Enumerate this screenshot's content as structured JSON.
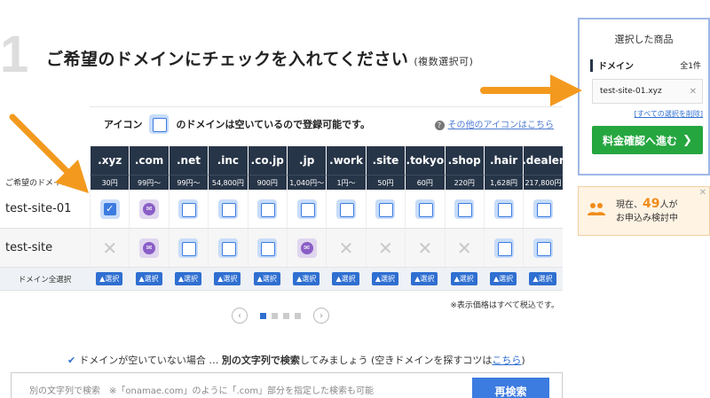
{
  "step": {
    "number": "1",
    "title": "ご希望のドメインにチェックを入れてください",
    "subtitle": "(複数選択可)"
  },
  "legend": {
    "icon_label": "アイコン",
    "desc": "のドメインは空いているので登録可能です。",
    "help_link": "その他のアイコンはこちら",
    "help_icon": "question-icon"
  },
  "table": {
    "row_header_label": "ご希望のドメイン",
    "tlds": [
      ".xyz",
      ".com",
      ".net",
      ".inc",
      ".co.jp",
      ".jp",
      ".work",
      ".site",
      ".tokyo",
      ".shop",
      ".hair",
      ".dealer"
    ],
    "prices": [
      "30円",
      "99円〜",
      "99円〜",
      "54,800円",
      "900円",
      "1,040円〜",
      "1円〜",
      "50円",
      "60円",
      "220円",
      "1,628円",
      "217,800円"
    ],
    "rows": [
      {
        "name": "test-site-01",
        "status": [
          "checked",
          "mail",
          "available",
          "available",
          "available",
          "available",
          "available",
          "available",
          "available",
          "available",
          "available",
          "available"
        ]
      },
      {
        "name": "test-site",
        "status": [
          "taken",
          "mail",
          "available",
          "available",
          "available",
          "mail",
          "taken",
          "taken",
          "taken",
          "taken",
          "available",
          "available"
        ]
      }
    ],
    "select_all_label": "ドメイン全選択",
    "select_label": "▲選択",
    "tax_note": "※表示価格はすべて税込です。"
  },
  "pager": {
    "prev": "‹",
    "next": "›",
    "pages": 4,
    "current": 1
  },
  "tip": {
    "prefix": "ドメインが空いていない場合 … ",
    "bold": "別の文字列で検索",
    "middle": "してみましょう (空きドメインを探すコツは",
    "link": "こちら",
    "suffix": ")"
  },
  "search": {
    "placeholder": "別の文字列で検索　※「onamae.com」のように「.com」部分を指定した検索も可能",
    "button": "再検索"
  },
  "cart": {
    "title": "選択した商品",
    "section": "ドメイン",
    "count": "全1件",
    "items": [
      "test-site-01.xyz"
    ],
    "clear_all": "[すべての選択を削除]",
    "proceed": "料金確認へ進む",
    "proceed_icon": "chevron-right-icon"
  },
  "live": {
    "prefix": "現在、",
    "count": "49",
    "suffix": "人が",
    "line2": "お申込み検討中",
    "icon": "people-icon"
  },
  "colors": {
    "header_navy": "#273548",
    "accent_blue": "#2f6fd1",
    "proceed_green": "#25a63f",
    "annotation_orange": "#f39a1e"
  }
}
